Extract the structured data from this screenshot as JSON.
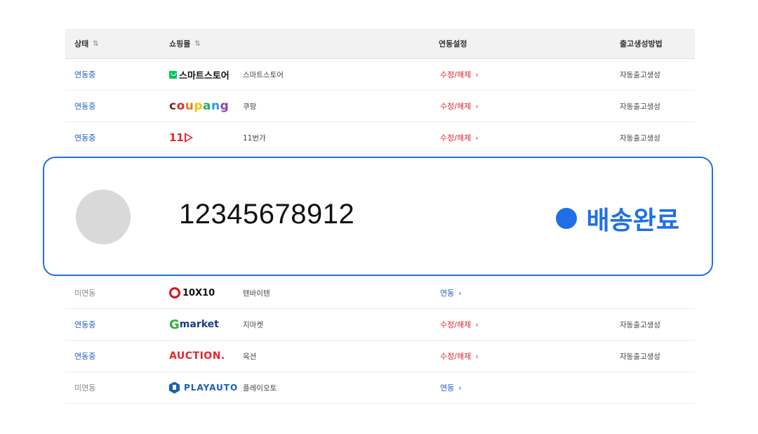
{
  "header": {
    "status": "상태",
    "mall": "쇼핑몰",
    "link": "연동설정",
    "method": "출고생성방법",
    "sort_icon": "sort-icon"
  },
  "rows": [
    {
      "status": "연동중",
      "logo": "스마트스토어",
      "name": "스마트스토어",
      "link": "수정/해제",
      "method": "자동출고생성"
    },
    {
      "status": "연동중",
      "logo": "coupang",
      "name": "쿠팡",
      "link": "수정/해제",
      "method": "자동출고생성"
    },
    {
      "status": "연동중",
      "logo": "11",
      "name": "11번가",
      "link": "수정/해제",
      "method": "자동출고생성"
    },
    {
      "status": "미연동",
      "logo": "10X10",
      "name": "텐바이텐",
      "link": "연동",
      "method": ""
    },
    {
      "status": "연동중",
      "logo": "market",
      "logo_g": "G",
      "name": "지마켓",
      "link": "수정/해제",
      "method": "자동출고생성"
    },
    {
      "status": "연동중",
      "logo": "AUCTION.",
      "name": "옥션",
      "link": "수정/해제",
      "method": "자동출고생성"
    },
    {
      "status": "미연동",
      "logo": "PLAYAUTO",
      "name": "플레이오토",
      "link": "연동",
      "method": ""
    }
  ],
  "overlay": {
    "tracking_number": "12345678912",
    "delivery_status": "배송완료"
  },
  "colors": {
    "accent": "#1f6fe8",
    "active": "#1f5fbf",
    "edit": "#d8262b",
    "inactive": "#888888"
  }
}
